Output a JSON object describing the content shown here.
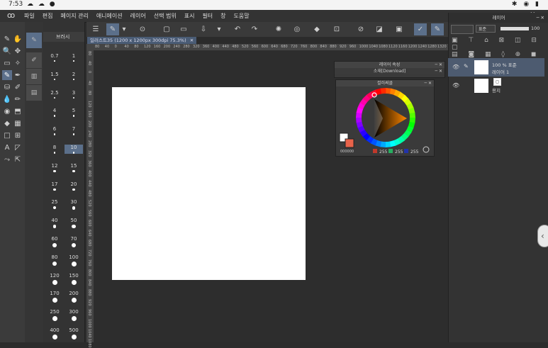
{
  "status_bar": {
    "time": "7:53",
    "left_icons": "☁ ☁ ●",
    "right_icons": "✱ ◉ ▮"
  },
  "menu": {
    "logo": "ꝏ",
    "items": [
      "파일",
      "편집",
      "페이지 관리",
      "애니메이션",
      "레이어",
      "선택 범위",
      "표시",
      "필터",
      "창",
      "도움말"
    ],
    "window_controls": "▭ ─ ✕"
  },
  "command_bar": {
    "buttons": [
      {
        "name": "menu-icon",
        "glyph": "☰"
      },
      {
        "name": "brush-mode-icon",
        "glyph": "✎"
      },
      {
        "name": "dropdown-icon",
        "glyph": "▾"
      },
      {
        "name": "view-icon",
        "glyph": "⊙"
      },
      {
        "name": "new-file-icon",
        "glyph": "▢"
      },
      {
        "name": "open-folder-icon",
        "glyph": "▭"
      },
      {
        "name": "save-icon",
        "glyph": "⇩"
      },
      {
        "name": "save-dropdown-icon",
        "glyph": "▾"
      },
      {
        "name": "undo-icon",
        "glyph": "↶"
      },
      {
        "name": "redo-icon",
        "glyph": "↷"
      },
      {
        "name": "settings-icon",
        "glyph": "✺"
      },
      {
        "name": "clear-icon",
        "glyph": "◎"
      },
      {
        "name": "fill-icon",
        "glyph": "◆"
      },
      {
        "name": "crop-icon",
        "glyph": "⊡"
      },
      {
        "name": "no-select-icon",
        "glyph": "⊘"
      },
      {
        "name": "tone-icon",
        "glyph": "◪"
      },
      {
        "name": "layer-icon",
        "glyph": "▣"
      },
      {
        "name": "pen-check-icon",
        "glyph": "✓"
      },
      {
        "name": "pen-sub-icon",
        "glyph": "✎"
      }
    ]
  },
  "tools": [
    {
      "name": "pen-tool-icon",
      "glyph": "✎",
      "on": false
    },
    {
      "name": "hand-tool-icon",
      "glyph": "✋",
      "on": false
    },
    {
      "name": "zoom-tool-icon",
      "glyph": "🔍",
      "on": false
    },
    {
      "name": "move-tool-icon",
      "glyph": "✥",
      "on": false
    },
    {
      "name": "selection-tool-icon",
      "glyph": "▭",
      "on": false
    },
    {
      "name": "magic-wand-icon",
      "glyph": "✧",
      "on": false
    },
    {
      "name": "brush-tool-icon",
      "glyph": "✎",
      "on": true
    },
    {
      "name": "eyedropper-icon",
      "glyph": "✒",
      "on": false
    },
    {
      "name": "fill-bucket-icon",
      "glyph": "⛁",
      "on": false
    },
    {
      "name": "airbrush-icon",
      "glyph": "✐",
      "on": false
    },
    {
      "name": "ink-drop-icon",
      "glyph": "💧",
      "on": false
    },
    {
      "name": "marker-icon",
      "glyph": "✏",
      "on": false
    },
    {
      "name": "blend-icon",
      "glyph": "◉",
      "on": false
    },
    {
      "name": "eraser-icon",
      "glyph": "⬒",
      "on": false
    },
    {
      "name": "paint-bucket-icon",
      "glyph": "◆",
      "on": false
    },
    {
      "name": "gradient-icon",
      "glyph": "▦",
      "on": false
    },
    {
      "name": "frame-icon",
      "glyph": "□",
      "on": false
    },
    {
      "name": "ruler-icon",
      "glyph": "⊞",
      "on": false
    },
    {
      "name": "text-tool-icon",
      "glyph": "A",
      "on": false
    },
    {
      "name": "balloon-icon",
      "glyph": "◸",
      "on": false
    },
    {
      "name": "correct-line-icon",
      "glyph": "⤳",
      "on": false
    },
    {
      "name": "operation-icon",
      "glyph": "⇱",
      "on": false
    }
  ],
  "brush_panel": {
    "title": "브러시",
    "sizes": [
      "0.7",
      "1",
      "1.5",
      "2",
      "2.5",
      "3",
      "4",
      "5",
      "6",
      "7",
      "8",
      "10",
      "12",
      "15",
      "17",
      "20",
      "25",
      "30",
      "40",
      "50",
      "60",
      "70",
      "80",
      "100",
      "120",
      "150",
      "170",
      "200",
      "250",
      "300",
      "400",
      "500"
    ],
    "selected": "10"
  },
  "document_tab": {
    "label": "일러스트35 (1200 x 1200px 300dpi 75.3%)",
    "close": "✕"
  },
  "ruler_ticks": [
    "80",
    "40",
    "0",
    "40",
    "80",
    "120",
    "160",
    "200",
    "240",
    "280",
    "320",
    "360",
    "400",
    "440",
    "480",
    "520",
    "560",
    "600",
    "640",
    "680",
    "720",
    "760",
    "800",
    "840",
    "880",
    "920",
    "960",
    "1000",
    "1040",
    "1080",
    "1120",
    "1160",
    "1200",
    "1240",
    "1280",
    "1320"
  ],
  "layer_property_panel": {
    "title": "레이어 속성",
    "subtitle": "소재[Download]"
  },
  "color_panel": {
    "title": "컬러써클",
    "rgb": {
      "r": "255",
      "g": "255",
      "b": "255"
    },
    "hex_label": "000000",
    "main_color": "#ffffff",
    "sub_color": "#e8634a"
  },
  "layer_panel": {
    "title": "레이어",
    "blend_mode": "표준",
    "opacity": "100",
    "layers": [
      {
        "line1": "100 % 표준",
        "line2": "레이어 1",
        "selected": true
      },
      {
        "line1": "",
        "line2": "용지",
        "selected": false
      }
    ]
  },
  "edge_button": "‹"
}
